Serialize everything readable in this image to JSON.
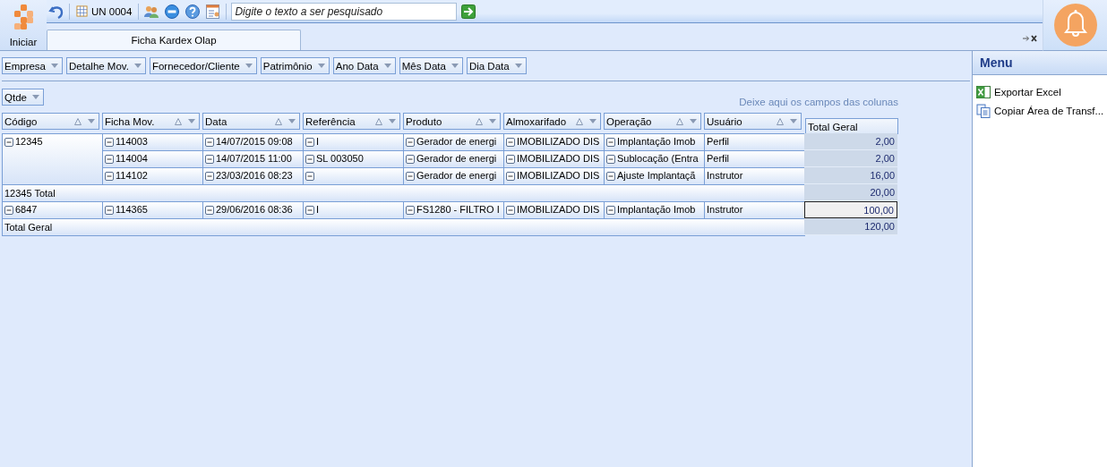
{
  "app": {
    "start_label": "Iniciar"
  },
  "toolbar": {
    "unit": "UN 0004",
    "search": {
      "placeholder": "Digite o texto a ser pesquisado"
    }
  },
  "tabs": [
    {
      "label": "Ficha Kardex Olap",
      "selected": true
    }
  ],
  "filter_fields": [
    "Empresa",
    "Detalhe Mov.",
    "Fornecedor/Cliente",
    "Patrimônio",
    "Ano Data",
    "Mês Data",
    "Dia Data"
  ],
  "data_fields": [
    "Qtde"
  ],
  "column_area_hint": "Deixe aqui os campos das colunas",
  "row_fields": [
    {
      "label": "Código",
      "expanded": true
    },
    {
      "label": "Ficha Mov.",
      "expanded": true
    },
    {
      "label": "Data",
      "expanded": true
    },
    {
      "label": "Referência",
      "expanded": true
    },
    {
      "label": "Produto",
      "expanded": true
    },
    {
      "label": "Almoxarifado",
      "expanded": true
    },
    {
      "label": "Operação",
      "expanded": true
    },
    {
      "label": "Usuário",
      "expanded": false
    }
  ],
  "value_header": "Total Geral",
  "groups": [
    {
      "code": "12345",
      "rows": [
        {
          "cells": [
            "114003",
            "14/07/2015 09:08",
            "I",
            "Gerador de energi",
            "IMOBILIZADO DIS",
            "Implantação Imob",
            "Perfil"
          ],
          "value": "2,00",
          "selected": false
        },
        {
          "cells": [
            "114004",
            "14/07/2015 11:00",
            "SL 003050",
            "Gerador de energi",
            "IMOBILIZADO DIS",
            "Sublocação (Entra",
            "Perfil"
          ],
          "value": "2,00",
          "selected": false
        },
        {
          "cells": [
            "114102",
            "23/03/2016 08:23",
            null,
            "Gerador de energi",
            "IMOBILIZADO DIS",
            "Ajuste Implantaçã",
            "Instrutor"
          ],
          "value": "16,00",
          "selected": false
        }
      ],
      "total_label": "12345 Total",
      "total": "20,00"
    },
    {
      "code": "6847",
      "rows": [
        {
          "cells": [
            "114365",
            "29/06/2016 08:36",
            "I",
            "FS1280 - FILTRO I",
            "IMOBILIZADO DIS",
            "Implantação Imob",
            "Instrutor"
          ],
          "value": "100,00",
          "selected": true
        }
      ]
    }
  ],
  "grand_total_label": "Total Geral",
  "grand_total": "120,00",
  "menu": {
    "title": "Menu",
    "items": [
      {
        "kind": "excel",
        "label": "Exportar Excel"
      },
      {
        "kind": "copy",
        "label": "Copiar Área de Transf..."
      }
    ]
  }
}
